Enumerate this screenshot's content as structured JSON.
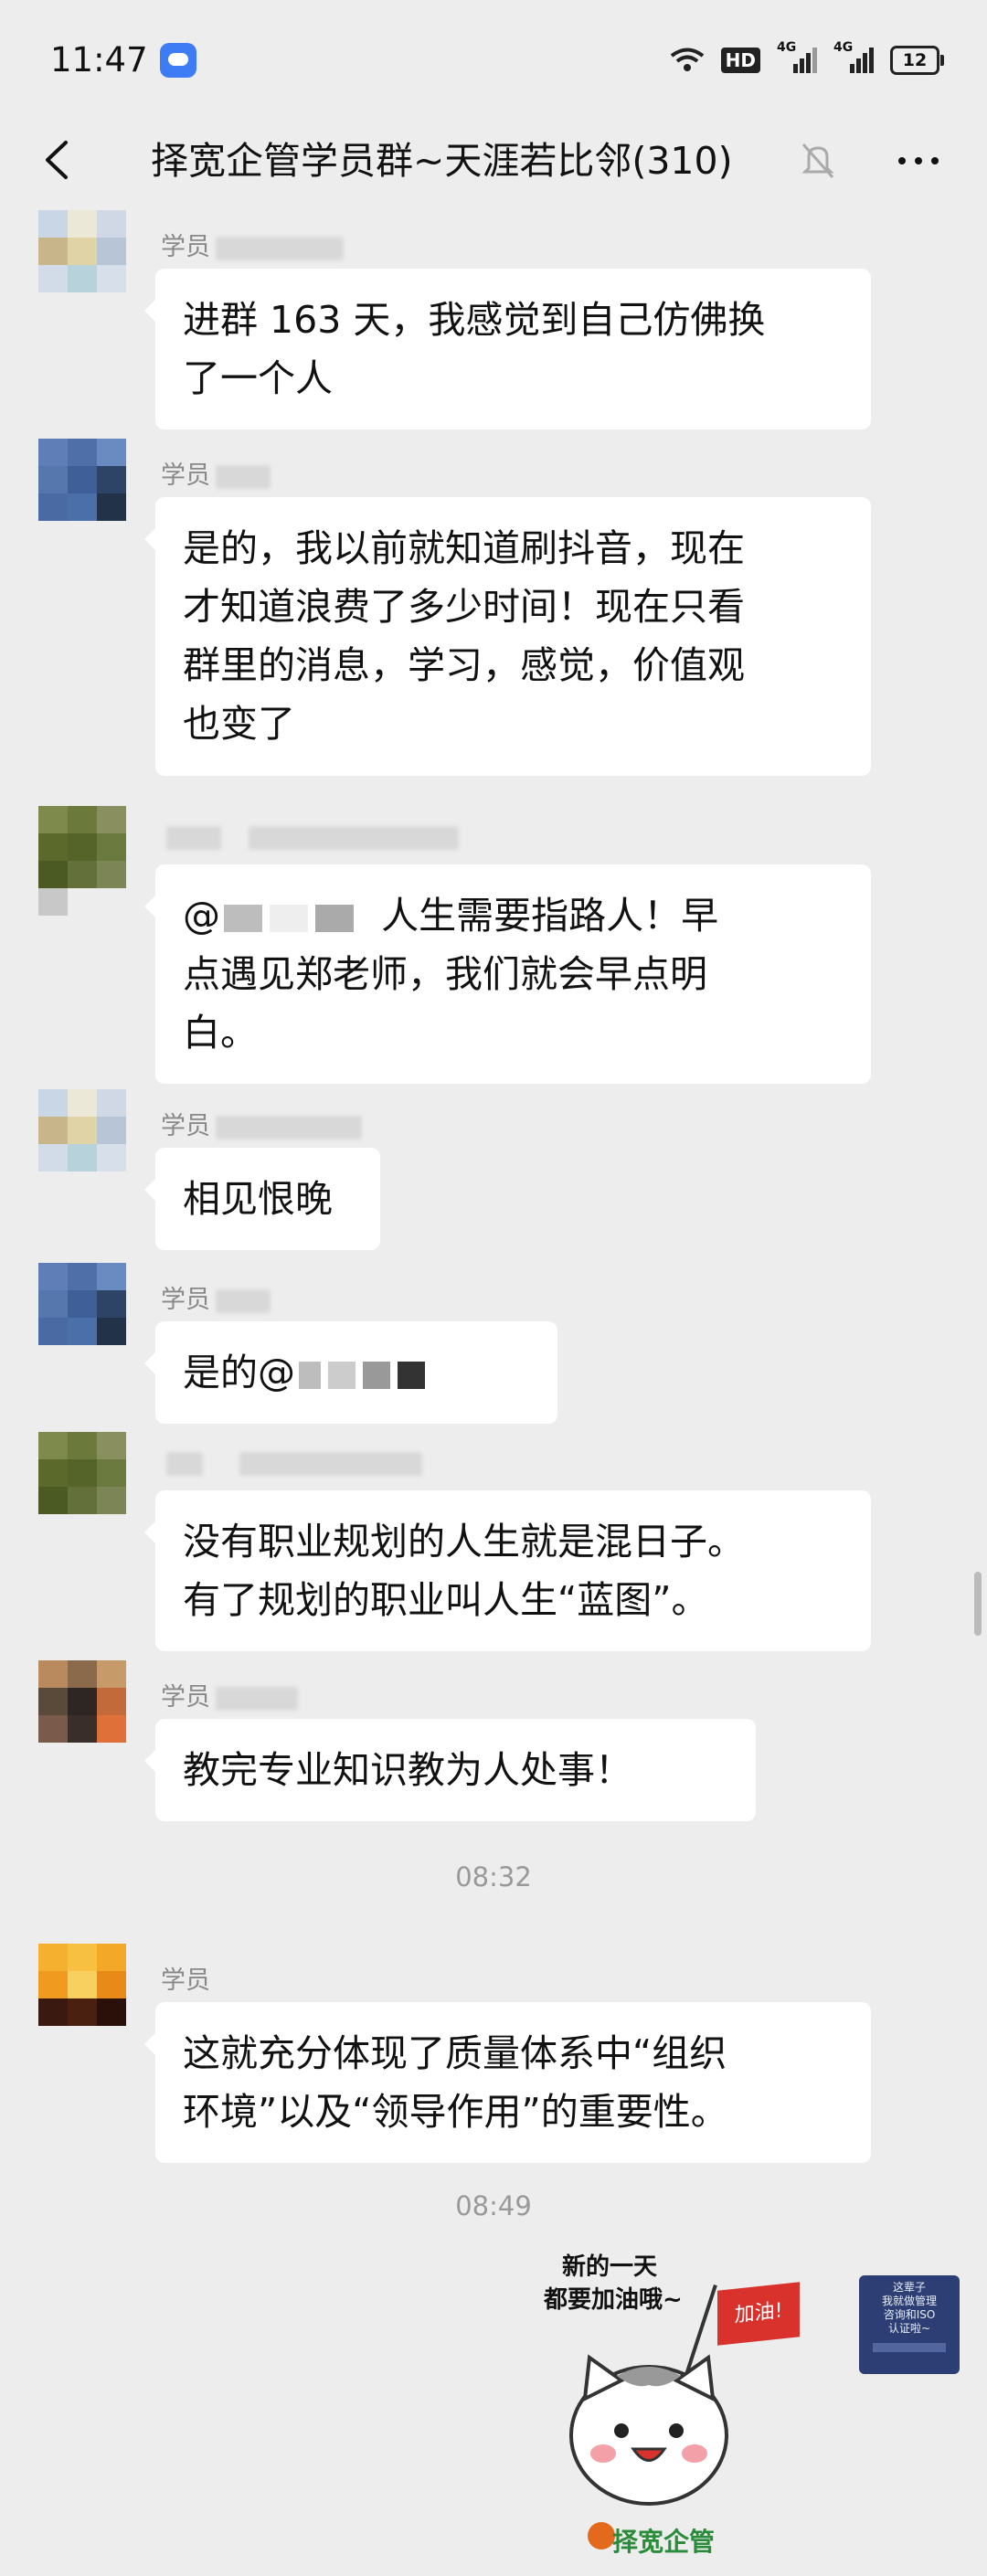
{
  "status_bar": {
    "time": "11:47",
    "hd_label": "HD",
    "sim1_label": "4G",
    "sim2_label": "4G",
    "battery": "12"
  },
  "nav": {
    "title": "择宽企管学员群~天涯若比邻(310)"
  },
  "messages": [
    {
      "sender": "学员",
      "text_lines": [
        "进群 163 天，我感觉到自己仿佛换",
        "了一个人"
      ]
    },
    {
      "sender": "学员",
      "text_lines": [
        "是的，我以前就知道刷抖音，现在",
        "才知道浪费了多少时间！现在只看",
        "群里的消息，学习，感觉，价值观",
        "也变了"
      ]
    },
    {
      "sender": "",
      "prefix": "@",
      "text_lines": [
        "人生需要指路人！早",
        "点遇见郑老师，我们就会早点明",
        "白。"
      ]
    },
    {
      "sender": "学员",
      "text_lines": [
        "相见恨晚"
      ]
    },
    {
      "sender": "学员",
      "text_lines": [
        "是的@"
      ]
    },
    {
      "sender": "",
      "text_lines": [
        "没有职业规划的人生就是混日子。",
        "有了规划的职业叫人生“蓝图”。"
      ]
    },
    {
      "sender": "学员",
      "text_lines": [
        "教完专业知识教为人处事！"
      ]
    },
    {
      "sender": "学员",
      "text_lines": [
        "这就充分体现了质量体系中“组织",
        "环境”以及“领导作用”的重要性。"
      ]
    }
  ],
  "timestamps": [
    "08:32",
    "08:49"
  ],
  "sticker": {
    "caption_line1": "新的一天",
    "caption_line2": "都要加油哦~",
    "flag_text": "加油!",
    "brand": "择宽企管"
  },
  "card_thumb": {
    "lines": [
      "这辈子",
      "我就做管理",
      "咨询和ISO",
      "认证啦~"
    ]
  }
}
